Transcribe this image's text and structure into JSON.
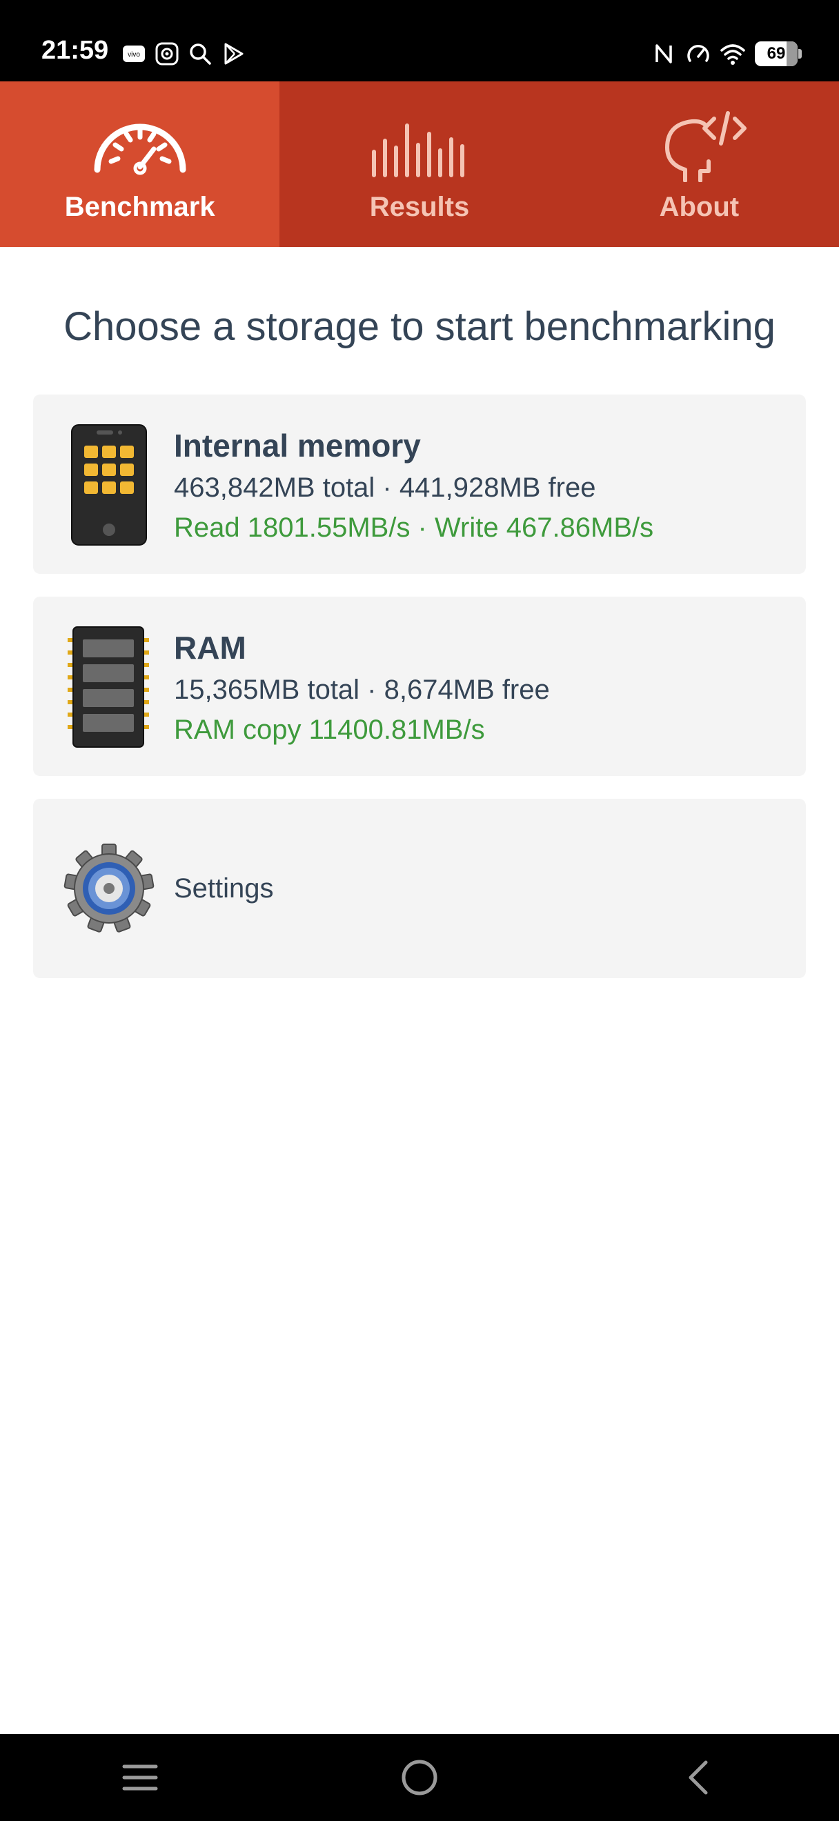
{
  "status_bar": {
    "time": "21:59",
    "battery": "69",
    "left_icons": [
      "vivo-icon",
      "camera-app-icon",
      "search-icon",
      "play-store-icon"
    ],
    "right_icons": [
      "nfc-icon",
      "speed-icon",
      "wifi-icon",
      "battery-icon"
    ]
  },
  "tabs": [
    {
      "label": "Benchmark",
      "icon": "speedometer-icon",
      "active": true
    },
    {
      "label": "Results",
      "icon": "bars-icon",
      "active": false
    },
    {
      "label": "About",
      "icon": "head-code-icon",
      "active": false
    }
  ],
  "main": {
    "heading": "Choose a storage to start benchmarking",
    "cards": [
      {
        "title": "Internal memory",
        "info": "463,842MB total · 441,928MB free",
        "speed": "Read 1801.55MB/s · Write 467.86MB/s",
        "icon": "phone-icon"
      },
      {
        "title": "RAM",
        "info": "15,365MB total · 8,674MB free",
        "speed": "RAM copy 11400.81MB/s",
        "icon": "ram-chip-icon"
      }
    ],
    "settings": {
      "label": "Settings",
      "icon": "gear-icon"
    }
  },
  "nav_bar": {
    "buttons": [
      "menu-icon",
      "home-icon",
      "back-icon"
    ]
  },
  "colors": {
    "tab_bar": "#b8351f",
    "tab_active": "#d64c2f",
    "text": "#344456",
    "speed_green": "#3e9a3c",
    "card_bg": "#f4f4f4"
  }
}
